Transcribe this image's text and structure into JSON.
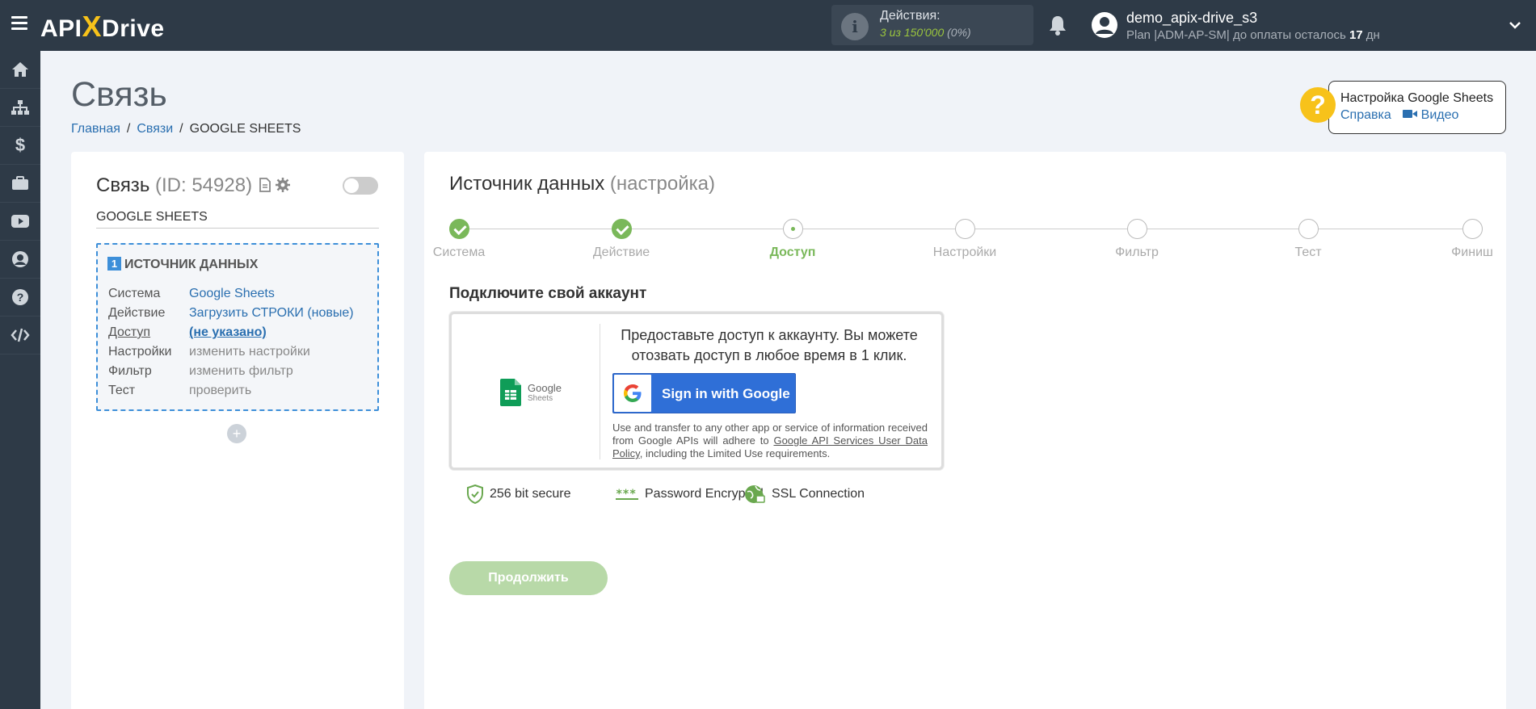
{
  "topbar": {
    "logo_api": "API",
    "logo_x": "X",
    "logo_drive": "Drive",
    "actions_title": "Действия:",
    "actions_count": "3 из 150'000",
    "actions_pct": "(0%)",
    "user_name": "demo_apix-drive_s3",
    "user_plan_prefix": "Plan |ADM-AP-SM| до оплаты осталось",
    "user_plan_days": "17",
    "user_plan_suffix": "дн"
  },
  "sidebar": {
    "items": [
      {
        "icon": "home-icon"
      },
      {
        "icon": "sitemap-icon"
      },
      {
        "icon": "dollar-icon"
      },
      {
        "icon": "briefcase-icon"
      },
      {
        "icon": "youtube-icon"
      },
      {
        "icon": "user-circle-icon"
      },
      {
        "icon": "question-icon"
      },
      {
        "icon": "code-icon"
      }
    ]
  },
  "header": {
    "title": "Связь",
    "breadcrumb": [
      "Главная",
      "Связи",
      "GOOGLE SHEETS"
    ]
  },
  "help": {
    "q": "?",
    "title": "Настройка Google Sheets",
    "link_help": "Справка",
    "link_video": "Видео"
  },
  "left": {
    "title": "Связь",
    "id": "(ID: 54928)",
    "name": "GOOGLE SHEETS",
    "source": {
      "num": "1",
      "title": "ИСТОЧНИК ДАННЫХ",
      "rows": [
        {
          "k": "Система",
          "v": "Google Sheets"
        },
        {
          "k": "Действие",
          "v": "Загрузить СТРОКИ (новые)"
        },
        {
          "k": "Доступ",
          "v": "(не указано)"
        },
        {
          "k": "Настройки",
          "v": "изменить настройки"
        },
        {
          "k": "Фильтр",
          "v": "изменить фильтр"
        },
        {
          "k": "Тест",
          "v": "проверить"
        }
      ]
    },
    "plus": "+"
  },
  "main": {
    "title": "Источник данных",
    "subtitle": "(настройка)",
    "steps": [
      "Система",
      "Действие",
      "Доступ",
      "Настройки",
      "Фильтр",
      "Тест",
      "Финиш"
    ],
    "connect_heading": "Подключите свой аккаунт",
    "gs_logo_1": "Google",
    "gs_logo_2": "Sheets",
    "auth_text": "Предоставьте доступ к аккаунту. Вы можете отозвать доступ в любое время в 1 клик.",
    "google_button": "Sign in with Google",
    "small_prefix": "Use and transfer to any other app or service of information received from Google APIs will adhere to",
    "small_link": "Google API Services User Data Policy",
    "small_suffix": ", including the Limited Use requirements.",
    "badges": [
      "256 bit secure",
      "Password Encrypted",
      "SSL Connection"
    ],
    "continue": "Продолжить"
  },
  "colors": {
    "topbar": "#2e3a47",
    "accent_green": "#7ab85a",
    "link_blue": "#2a6fb0",
    "google_blue": "#2f6fd7",
    "logo_yellow": "#f7c21a"
  }
}
